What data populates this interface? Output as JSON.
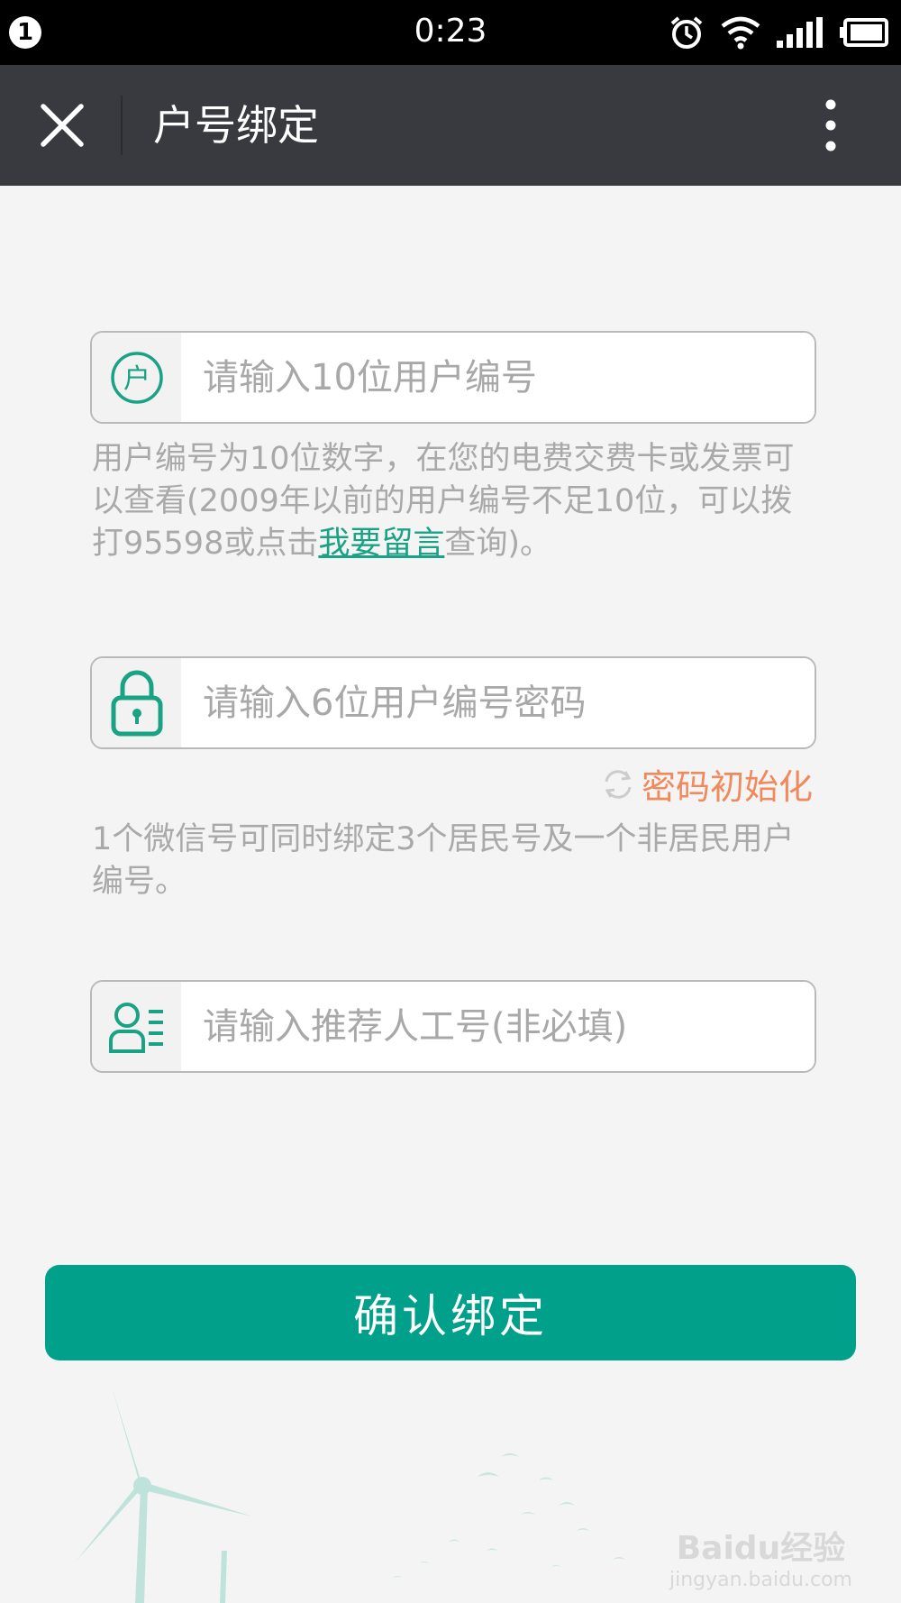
{
  "status_bar": {
    "notification_count": "1",
    "time": "0:23",
    "icons": [
      "alarm-icon",
      "wifi-icon",
      "signal-icon",
      "battery-icon"
    ]
  },
  "nav": {
    "title": "户号绑定",
    "close_icon": "close-icon",
    "more_icon": "more-vertical-icon"
  },
  "form": {
    "account": {
      "icon": "account-icon",
      "icon_glyph": "户",
      "placeholder": "请输入10位用户编号",
      "value": ""
    },
    "account_hint": {
      "text": "用户编号为10位数字，在您的电费交费卡或发票可以查看(2009年以前的用户编号不足10位，可以拨打95598或点击",
      "link": "我要留言",
      "suffix": "查询)。"
    },
    "password": {
      "icon": "lock-icon",
      "placeholder": "请输入6位用户编号密码",
      "value": ""
    },
    "reset_password": {
      "icon": "refresh-icon",
      "label": "密码初始化"
    },
    "binding_hint": "1个微信号可同时绑定3个居民号及一个非居民用户编号。",
    "referrer": {
      "icon": "contact-card-icon",
      "placeholder": "请输入推荐人工号(非必填)",
      "value": ""
    },
    "confirm_label": "确认绑定"
  },
  "watermark": {
    "main": "Baidu经验",
    "sub": "jingyan.baidu.com"
  },
  "colors": {
    "accent": "#00a08a",
    "link": "#1aa285",
    "reset": "#f08a5d",
    "navbar": "#393a3f",
    "background": "#f4f4f4"
  }
}
